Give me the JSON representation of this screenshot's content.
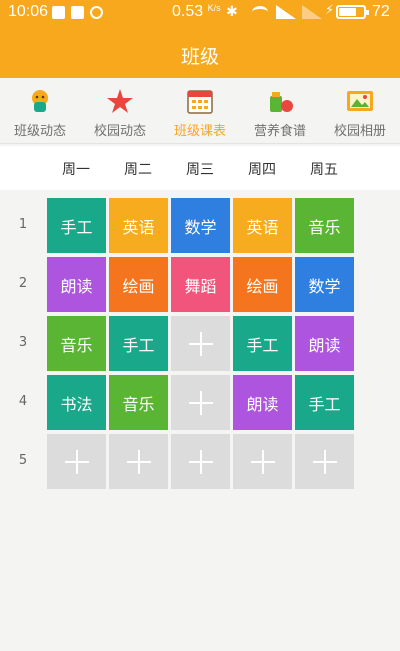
{
  "status_bar": {
    "time": "10:06",
    "speed": "0.53",
    "speed_unit": "K/s",
    "battery": "72",
    "battery_level": 0.72
  },
  "header": {
    "title": "班级"
  },
  "tabs": [
    {
      "label": "班级动态",
      "icon": "teacher-icon",
      "active": false
    },
    {
      "label": "校园动态",
      "icon": "star-icon",
      "active": false
    },
    {
      "label": "班级课表",
      "icon": "calendar-icon",
      "active": true
    },
    {
      "label": "营养食谱",
      "icon": "food-icon",
      "active": false
    },
    {
      "label": "校园相册",
      "icon": "photo-album-icon",
      "active": false
    }
  ],
  "weekdays": [
    "周一",
    "周二",
    "周三",
    "周四",
    "周五"
  ],
  "periods": [
    "1",
    "2",
    "3",
    "4",
    "5"
  ],
  "schedule": [
    [
      {
        "subject": "手工",
        "color": "#1aa88a"
      },
      {
        "subject": "英语",
        "color": "#f7ab1e"
      },
      {
        "subject": "数学",
        "color": "#2f7fe0"
      },
      {
        "subject": "英语",
        "color": "#f7ab1e"
      },
      {
        "subject": "音乐",
        "color": "#5ab534"
      }
    ],
    [
      {
        "subject": "朗读",
        "color": "#ad55df"
      },
      {
        "subject": "绘画",
        "color": "#f5751f"
      },
      {
        "subject": "舞蹈",
        "color": "#f2557b"
      },
      {
        "subject": "绘画",
        "color": "#f5751f"
      },
      {
        "subject": "数学",
        "color": "#2f7fe0"
      }
    ],
    [
      {
        "subject": "音乐",
        "color": "#5ab534"
      },
      {
        "subject": "手工",
        "color": "#1aa88a"
      },
      null,
      {
        "subject": "手工",
        "color": "#1aa88a"
      },
      {
        "subject": "朗读",
        "color": "#ad55df"
      }
    ],
    [
      {
        "subject": "书法",
        "color": "#1aa88a"
      },
      {
        "subject": "音乐",
        "color": "#5ab534"
      },
      null,
      {
        "subject": "朗读",
        "color": "#ad55df"
      },
      {
        "subject": "手工",
        "color": "#1aa88a"
      }
    ],
    [
      null,
      null,
      null,
      null,
      null
    ]
  ],
  "colors": {
    "accent": "#f7a81d",
    "empty_cell": "#dcdcdc"
  }
}
